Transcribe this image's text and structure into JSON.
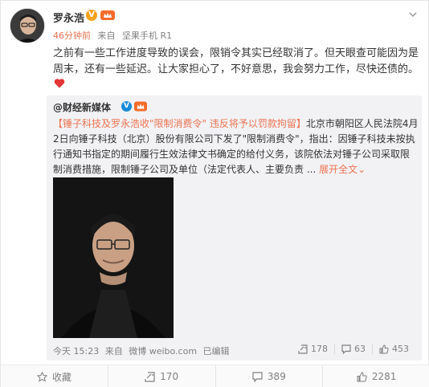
{
  "post": {
    "username": "罗永浩",
    "verified_badge": "V",
    "time": "46分钟前",
    "source_prefix": "来自",
    "source": "坚果手机 R1",
    "text": "之前有一些工作进度导致的误会，限销令其实已经取消了。但天眼查可能因为是周末，还有一些延迟。让大家担心了，不好意思，我会努力工作，尽快还债的。"
  },
  "repost": {
    "author": "@财经新媒体",
    "verified_badge": "V",
    "headline": "【锤子科技及罗永浩收\"限制消费令\" 违反将予以罚款拘留】",
    "text": "北京市朝阳区人民法院4月2日向锤子科技（北京）股份有限公司下发了\"限制消费令\"，指出：因锤子科技未按执行通知书指定的期间履行生效法律文书确定的给付义务，该院依法对锤子公司采取限制消费措施，限制锤子公司及单位（法定代表人、主要负责 ...",
    "expand": "展开全文",
    "expand_arrow": "⌄",
    "time": "今天 15:23",
    "source_prefix": "来自",
    "source": "微博 weibo.com",
    "edited": "已编辑",
    "repost_count": "178",
    "comment_count": "63",
    "like_count": "453"
  },
  "actions": {
    "favorite": "收藏",
    "repost": "170",
    "comment": "389",
    "like": "2281"
  }
}
